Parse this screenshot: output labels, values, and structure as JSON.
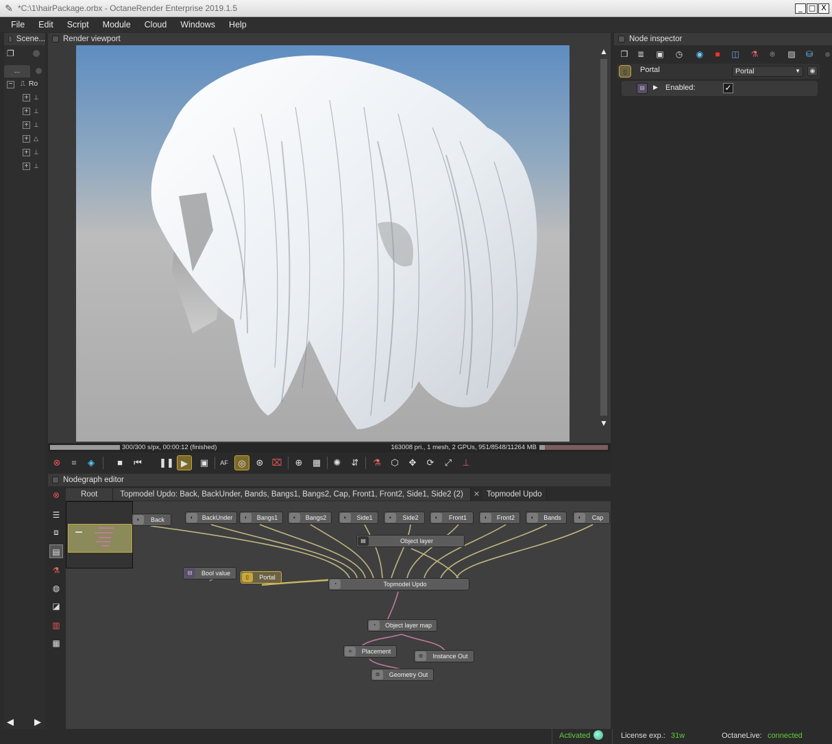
{
  "window": {
    "title": "*C:\\1\\hairPackage.orbx - OctaneRender Enterprise 2019.1.5",
    "min": "_",
    "max": "□",
    "close": "X"
  },
  "menu": [
    "File",
    "Edit",
    "Script",
    "Module",
    "Cloud",
    "Windows",
    "Help"
  ],
  "scene_outliner": {
    "title": "Scene...",
    "tab": "...",
    "root_label": "Ro"
  },
  "render_viewport": {
    "title": "Render viewport",
    "status_left": "300/300 s/px, 00:00:12 (finished)",
    "status_right": "163008 pri., 1 mesh, 2 GPUs, 951/8548/11264 MB",
    "progress": 1.0,
    "memory_used_fraction": 0.08
  },
  "nodegraph": {
    "title": "Nodegraph editor",
    "tabs": [
      "Root",
      "Topmodel Updo: Back, BackUnder, Bands, Bangs1, Bangs2, Cap, Front1, Front2, Side1, Side2 (2)",
      "Topmodel Updo"
    ],
    "nodes": {
      "back": "Back",
      "backunder": "BackUnder",
      "bangs1": "Bangs1",
      "bangs2": "Bangs2",
      "side1": "Side1",
      "side2": "Side2",
      "front1": "Front1",
      "front2": "Front2",
      "bands": "Bands",
      "cap": "Cap",
      "object_layer": "Object layer",
      "bool_value": "Bool value",
      "portal": "Portal",
      "topmodel_updo": "Topmodel Updo",
      "object_layer_map": "Object layer map",
      "placement": "Placement",
      "instance_out": "Instance Out",
      "geometry_out": "Geometry Out"
    }
  },
  "inspector": {
    "title": "Node inspector",
    "node_name": "Portal",
    "node_type": "Portal",
    "param_label": "Enabled:",
    "param_checked": "✓"
  },
  "statusbar": {
    "activated": "Activated",
    "license_label": "License exp.:",
    "license_value": "31w",
    "live_label": "OctaneLive:",
    "live_value": "connected"
  },
  "colors": {
    "accent_green": "#5fcf3a",
    "selection_gold": "#c9a63a",
    "wire_yellow": "#cfc48a",
    "wire_pink": "#c07aa0"
  }
}
